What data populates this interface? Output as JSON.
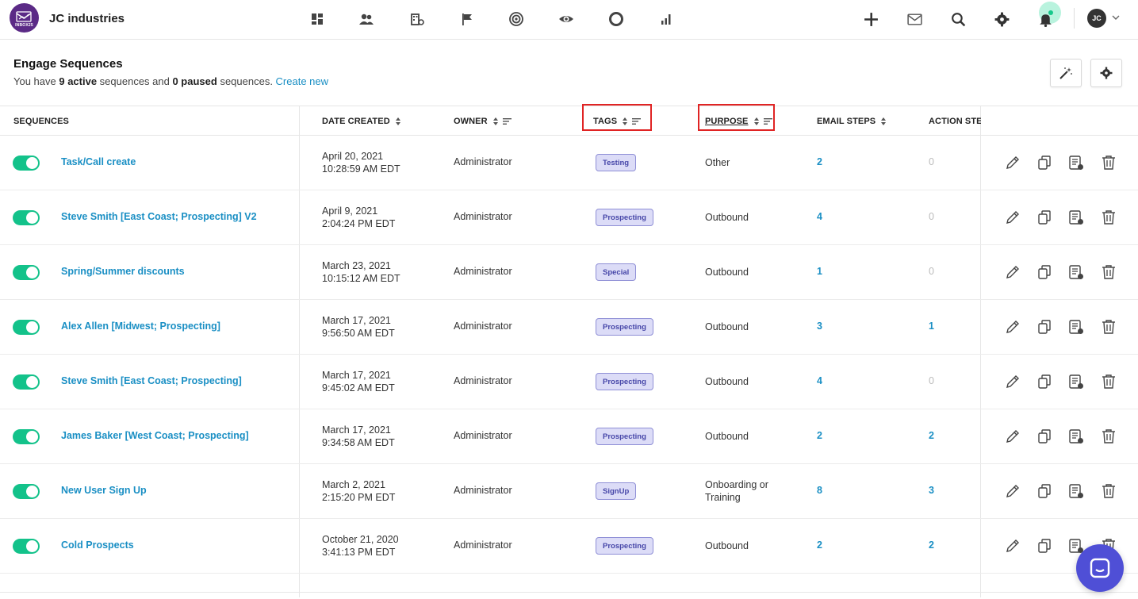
{
  "app": {
    "logo_text": "INBOX25",
    "company": "JC industries",
    "user_initials": "JC"
  },
  "nav_icons": [
    "dashboard-icon",
    "contacts-icon",
    "companies-icon",
    "flag-icon",
    "target-icon",
    "eye-icon",
    "circle-icon",
    "bar-chart-icon"
  ],
  "header": {
    "title": "Engage Sequences",
    "summary_prefix": "You have ",
    "active_count": "9 active",
    "summary_mid": " sequences and ",
    "paused_count": "0 paused",
    "summary_suffix": " sequences. ",
    "create_link": "Create new"
  },
  "columns": {
    "sequences": "SEQUENCES",
    "date_created": "DATE CREATED",
    "owner": "OWNER",
    "tags": "TAGS",
    "purpose": "PURPOSE",
    "email_steps": "EMAIL STEPS",
    "action_steps": "ACTION STEI"
  },
  "rows": [
    {
      "name": "Task/Call create",
      "date": "April 20, 2021",
      "time": "10:28:59 AM EDT",
      "owner": "Administrator",
      "tag": "Testing",
      "purpose": "Other",
      "purpose2": "",
      "email_steps": "2",
      "action_steps": "0"
    },
    {
      "name": "Steve Smith [East Coast; Prospecting] V2",
      "date": "April 9, 2021",
      "time": "2:04:24 PM EDT",
      "owner": "Administrator",
      "tag": "Prospecting",
      "purpose": "Outbound",
      "purpose2": "",
      "email_steps": "4",
      "action_steps": "0"
    },
    {
      "name": "Spring/Summer discounts",
      "date": "March 23, 2021",
      "time": "10:15:12 AM EDT",
      "owner": "Administrator",
      "tag": "Special",
      "purpose": "Outbound",
      "purpose2": "",
      "email_steps": "1",
      "action_steps": "0"
    },
    {
      "name": "Alex Allen [Midwest; Prospecting]",
      "date": "March 17, 2021",
      "time": "9:56:50 AM EDT",
      "owner": "Administrator",
      "tag": "Prospecting",
      "purpose": "Outbound",
      "purpose2": "",
      "email_steps": "3",
      "action_steps": "1"
    },
    {
      "name": "Steve Smith [East Coast; Prospecting]",
      "date": "March 17, 2021",
      "time": "9:45:02 AM EDT",
      "owner": "Administrator",
      "tag": "Prospecting",
      "purpose": "Outbound",
      "purpose2": "",
      "email_steps": "4",
      "action_steps": "0"
    },
    {
      "name": "James Baker [West Coast; Prospecting]",
      "date": "March 17, 2021",
      "time": "9:34:58 AM EDT",
      "owner": "Administrator",
      "tag": "Prospecting",
      "purpose": "Outbound",
      "purpose2": "",
      "email_steps": "2",
      "action_steps": "2"
    },
    {
      "name": "New User Sign Up",
      "date": "March 2, 2021",
      "time": "2:15:20 PM EDT",
      "owner": "Administrator",
      "tag": "SignUp",
      "purpose": "Onboarding or",
      "purpose2": "Training",
      "email_steps": "8",
      "action_steps": "3"
    },
    {
      "name": "Cold Prospects",
      "date": "October 21, 2020",
      "time": "3:41:13 PM EDT",
      "owner": "Administrator",
      "tag": "Prospecting",
      "purpose": "Outbound",
      "purpose2": "",
      "email_steps": "2",
      "action_steps": "2"
    }
  ],
  "colors": {
    "accent": "#1a8fc4",
    "toggle_on": "#13c28a",
    "tag_bg": "#dcdcf7",
    "highlight": "#e02424",
    "chat": "#4f4fd6"
  }
}
